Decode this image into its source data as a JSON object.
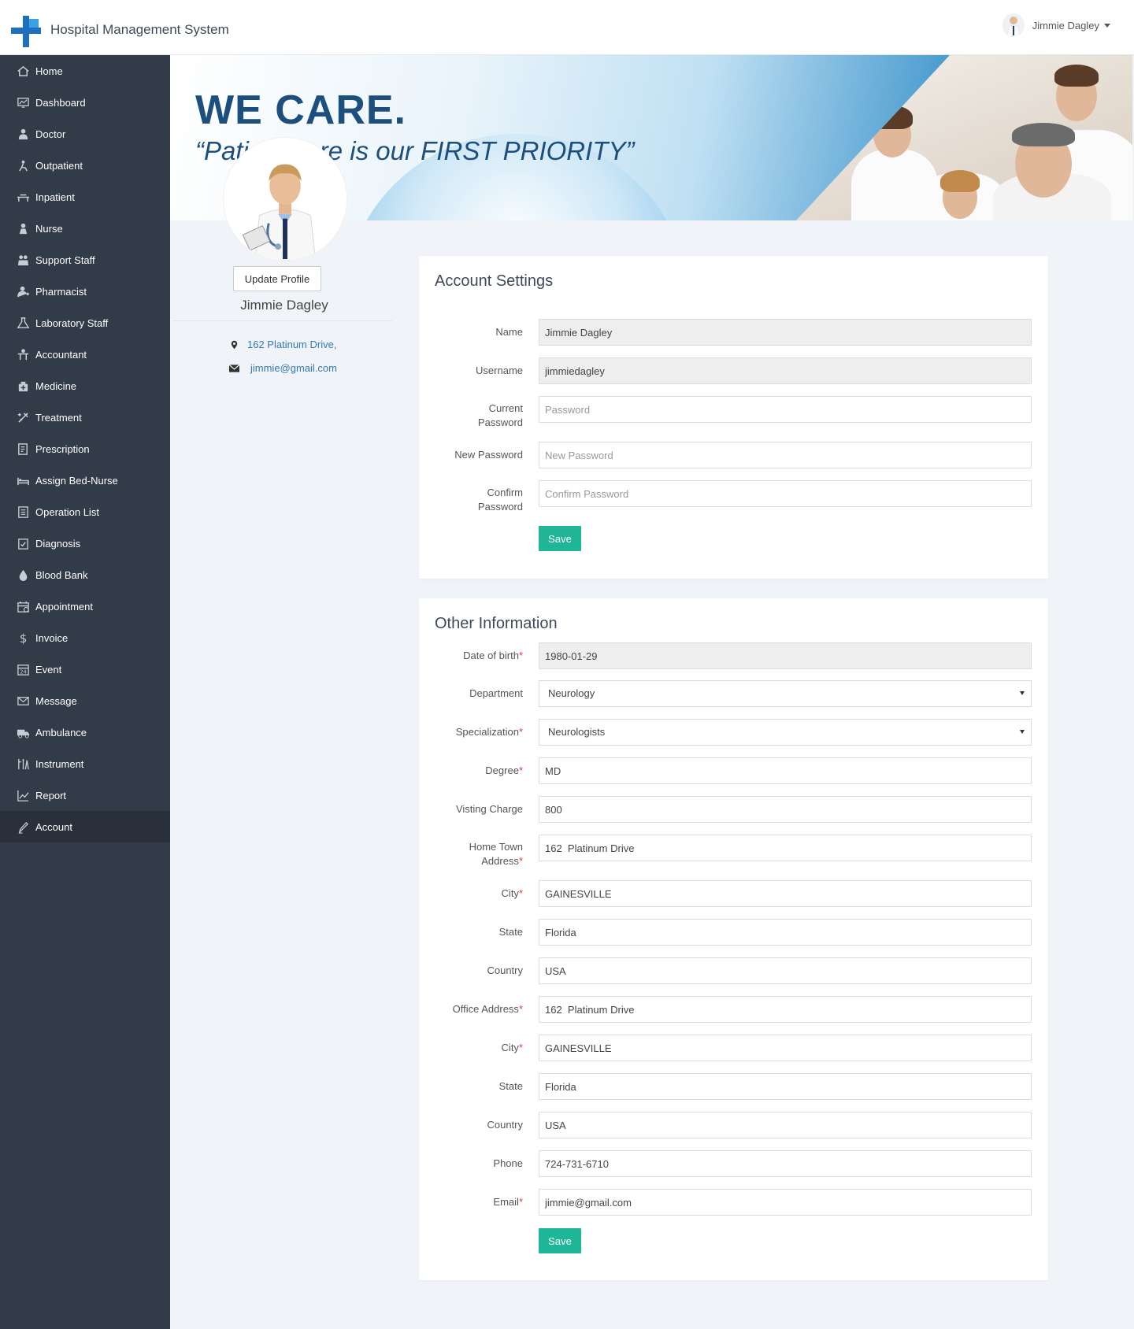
{
  "app": {
    "title": "Hospital Management System"
  },
  "user": {
    "name": "Jimmie Dagley"
  },
  "sidebar": {
    "items": [
      {
        "label": "Home",
        "icon": "home-icon"
      },
      {
        "label": "Dashboard",
        "icon": "dashboard-icon"
      },
      {
        "label": "Doctor",
        "icon": "doctor-icon"
      },
      {
        "label": "Outpatient",
        "icon": "outpatient-icon"
      },
      {
        "label": "Inpatient",
        "icon": "inpatient-icon"
      },
      {
        "label": "Nurse",
        "icon": "nurse-icon"
      },
      {
        "label": "Support Staff",
        "icon": "support-staff-icon"
      },
      {
        "label": "Pharmacist",
        "icon": "pharmacist-icon"
      },
      {
        "label": "Laboratory Staff",
        "icon": "flask-icon"
      },
      {
        "label": "Accountant",
        "icon": "accountant-icon"
      },
      {
        "label": "Medicine",
        "icon": "medicine-icon"
      },
      {
        "label": "Treatment",
        "icon": "treatment-icon"
      },
      {
        "label": "Prescription",
        "icon": "prescription-icon"
      },
      {
        "label": "Assign Bed-Nurse",
        "icon": "bed-icon"
      },
      {
        "label": "Operation List",
        "icon": "operation-list-icon"
      },
      {
        "label": "Diagnosis",
        "icon": "diagnosis-icon"
      },
      {
        "label": "Blood Bank",
        "icon": "blood-drop-icon"
      },
      {
        "label": "Appointment",
        "icon": "calendar-icon"
      },
      {
        "label": "Invoice",
        "icon": "dollar-icon"
      },
      {
        "label": "Event",
        "icon": "event-calendar-icon"
      },
      {
        "label": "Message",
        "icon": "envelope-icon"
      },
      {
        "label": "Ambulance",
        "icon": "ambulance-icon"
      },
      {
        "label": "Instrument",
        "icon": "instrument-icon"
      },
      {
        "label": "Report",
        "icon": "report-chart-icon"
      },
      {
        "label": "Account",
        "icon": "pencil-icon"
      }
    ],
    "active": "Account"
  },
  "banner": {
    "headline": "WE CARE.",
    "tagline": "“Patient care is our FIRST PRIORITY”"
  },
  "profile": {
    "update_button": "Update Profile",
    "name": "Jimmie Dagley",
    "address": "162 Platinum Drive,",
    "email": "jimmie@gmail.com"
  },
  "account_settings": {
    "title": "Account Settings",
    "name_label": "Name",
    "name_value": "Jimmie Dagley",
    "username_label": "Username",
    "username_value": "jimmiedagley",
    "current_password_label": "Current Password",
    "current_password_placeholder": "Password",
    "new_password_label": "New Password",
    "new_password_placeholder": "New Password",
    "confirm_password_label": "Confirm Password",
    "confirm_password_placeholder": "Confirm Password",
    "save_label": "Save"
  },
  "other_info": {
    "title": "Other Information",
    "dob_label": "Date of birth",
    "dob_value": "1980-01-29",
    "department_label": "Department",
    "department_value": "Neurology",
    "specialization_label": "Specialization",
    "specialization_value": "Neurologists",
    "degree_label": "Degree",
    "degree_value": "MD",
    "charge_label": "Visting Charge",
    "charge_value": "800",
    "home_address_label": "Home Town Address",
    "home_address_value": "162  Platinum Drive",
    "home_city_label": "City",
    "home_city_value": "GAINESVILLE",
    "home_state_label": "State",
    "home_state_value": "Florida",
    "home_country_label": "Country",
    "home_country_value": "USA",
    "office_address_label": "Office Address",
    "office_address_value": "162  Platinum Drive",
    "office_city_label": "City",
    "office_city_value": "GAINESVILLE",
    "office_state_label": "State",
    "office_state_value": "Florida",
    "office_country_label": "Country",
    "office_country_value": "USA",
    "phone_label": "Phone",
    "phone_value": "724-731-6710",
    "email_label": "Email",
    "email_value": "jimmie@gmail.com",
    "save_label": "Save"
  },
  "colors": {
    "sidebar_bg": "#323b48",
    "sidebar_active": "#29303b",
    "accent_save": "#1fb597",
    "link": "#337ab7",
    "required": "#e23b3b"
  }
}
